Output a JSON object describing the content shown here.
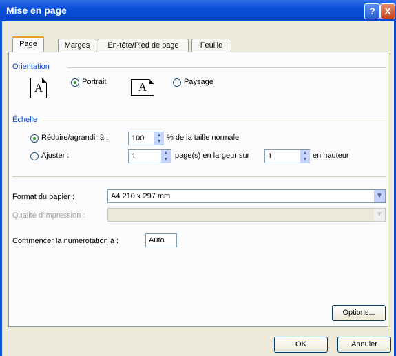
{
  "window": {
    "title": "Mise en page"
  },
  "tabs": [
    {
      "label": "Page"
    },
    {
      "label": "Marges"
    },
    {
      "label": "En-tête/Pied de page"
    },
    {
      "label": "Feuille"
    }
  ],
  "orientation": {
    "group_label": "Orientation",
    "portrait_label": "Portrait",
    "landscape_label": "Paysage",
    "selected": "Portrait",
    "icon_glyph": "A"
  },
  "scale": {
    "group_label": "Échelle",
    "reduce_label": "Réduire/agrandir à :",
    "reduce_value": "100",
    "reduce_suffix": "% de la taille normale",
    "fit_label": "Ajuster :",
    "fit_width_value": "1",
    "fit_width_suffix": "page(s) en largeur sur",
    "fit_height_value": "1",
    "fit_height_suffix": "en hauteur",
    "selected": "Réduire/agrandir à :"
  },
  "paper": {
    "format_label": "Format du papier :",
    "format_value": "A4 210 x 297 mm",
    "quality_label": "Qualité d'impression :",
    "quality_value": ""
  },
  "numbering": {
    "label": "Commencer la numérotation à :",
    "value": "Auto"
  },
  "buttons": {
    "options": "Options...",
    "ok": "OK",
    "cancel": "Annuler"
  },
  "titlebar_buttons": {
    "help": "?",
    "close": "X"
  }
}
